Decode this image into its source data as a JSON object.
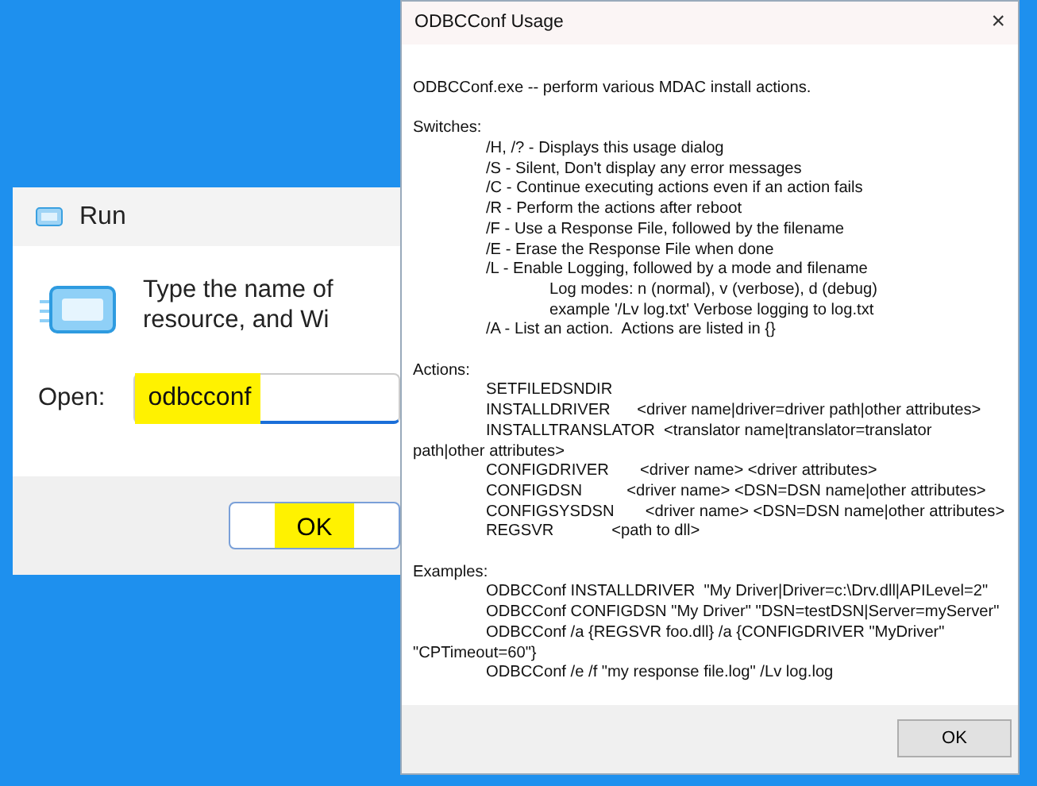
{
  "run_dialog": {
    "title": "Run",
    "prompt_lines": [
      "Type the name of",
      "resource, and Wi"
    ],
    "open_label": "Open:",
    "open_value": "odbcconf",
    "ok_button": "OK"
  },
  "usage_window": {
    "title": "ODBCConf Usage",
    "close": "×",
    "sections": [
      {
        "lines": [
          {
            "kind": "heading",
            "text": "ODBCConf.exe -- perform various MDAC install actions."
          }
        ]
      },
      {
        "lines": [
          {
            "kind": "heading",
            "text": "Switches:"
          },
          {
            "kind": "entry",
            "text": "/H, /? - Displays this usage dialog"
          },
          {
            "kind": "entry",
            "text": "/S - Silent, Don't display any error messages"
          },
          {
            "kind": "entry",
            "text": "/C - Continue executing actions even if an action fails"
          },
          {
            "kind": "entry",
            "text": "/R - Perform the actions after reboot"
          },
          {
            "kind": "entry",
            "text": "/F - Use a Response File, followed by the filename"
          },
          {
            "kind": "entry",
            "text": "/E - Erase the Response File when done"
          },
          {
            "kind": "entry",
            "text": "/L - Enable Logging, followed by a mode and filename"
          },
          {
            "kind": "detail",
            "text": "Log modes: n (normal), v (verbose), d (debug)"
          },
          {
            "kind": "detail",
            "text": "example '/Lv log.txt' Verbose logging to log.txt"
          },
          {
            "kind": "entry",
            "text": "/A - List an action.  Actions are listed in {}"
          }
        ]
      },
      {
        "lines": [
          {
            "kind": "heading",
            "text": "Actions:"
          },
          {
            "kind": "entry",
            "text": "SETFILEDSNDIR"
          },
          {
            "kind": "entry",
            "text": "INSTALLDRIVER      <driver name|driver=driver path|other attributes>"
          },
          {
            "kind": "entry",
            "text": "INSTALLTRANSLATOR  <translator name|translator=translator"
          },
          {
            "kind": "heading",
            "text": "path|other attributes>"
          },
          {
            "kind": "entry",
            "text": "CONFIGDRIVER       <driver name> <driver attributes>"
          },
          {
            "kind": "entry",
            "text": "CONFIGDSN          <driver name> <DSN=DSN name|other attributes>"
          },
          {
            "kind": "entry",
            "text": "CONFIGSYSDSN       <driver name> <DSN=DSN name|other attributes>"
          },
          {
            "kind": "entry",
            "text": "REGSVR             <path to dll>"
          }
        ]
      },
      {
        "lines": [
          {
            "kind": "heading",
            "text": "Examples:"
          },
          {
            "kind": "entry",
            "text": "ODBCConf INSTALLDRIVER  \"My Driver|Driver=c:\\Drv.dll|APILevel=2\""
          },
          {
            "kind": "entry",
            "text": "ODBCConf CONFIGDSN \"My Driver\" \"DSN=testDSN|Server=myServer\""
          },
          {
            "kind": "entry",
            "text": "ODBCConf /a {REGSVR foo.dll} /a {CONFIGDRIVER \"MyDriver\""
          },
          {
            "kind": "heading",
            "text": "\"CPTimeout=60\"}"
          },
          {
            "kind": "entry",
            "text": "ODBCConf /e /f \"my response file.log\" /Lv log.log"
          }
        ]
      }
    ],
    "ok_button": "OK"
  }
}
